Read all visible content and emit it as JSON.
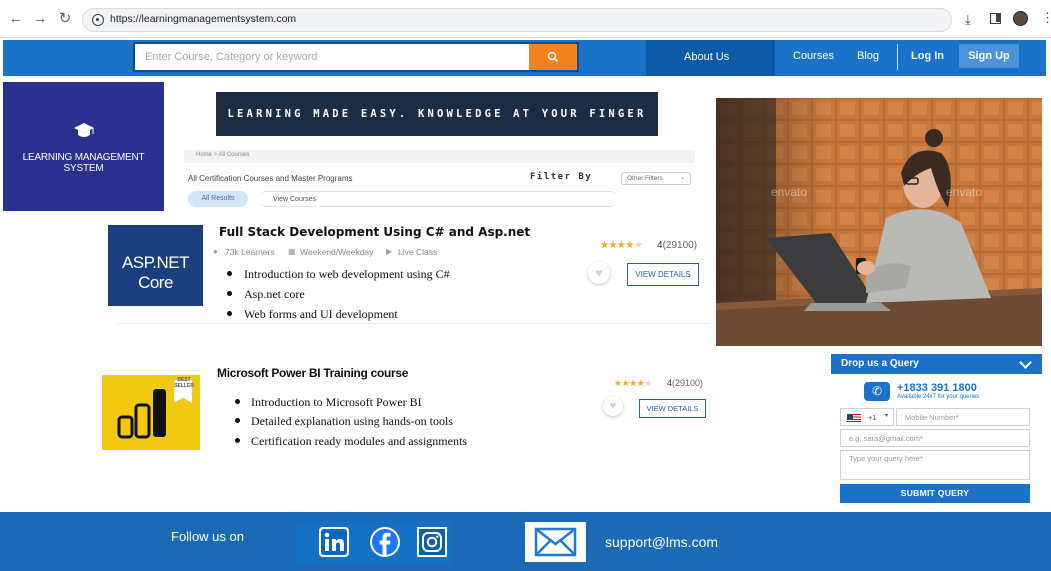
{
  "browser": {
    "url": "https://learningmanagementsystem.com",
    "icons": [
      "back-arrow-icon",
      "forward-arrow-icon",
      "reload-icon",
      "site-info-icon",
      "download-icon",
      "sidepanel-icon",
      "profile-icon",
      "more-icon"
    ]
  },
  "header": {
    "search_placeholder": "Enter Course, Category or keyword",
    "search_icon": "search-icon",
    "nav": {
      "about": "About Us",
      "courses": "Courses",
      "blog": "Blog",
      "login": "Log In",
      "signup": "Sign Up"
    }
  },
  "logo": {
    "title": "LEARNING MANAGEMENT SYSTEM",
    "icon": "graduation-cap-icon"
  },
  "banner": {
    "text": "LEARNING MADE EASY. KNOWLEDGE AT YOUR FINGER TIPS"
  },
  "listing": {
    "breadcrumb": "Home  >  All Courses",
    "heading": "All Certification Courses and Master Programs",
    "filter_by": "Filter By",
    "other_filters": "Other Filters",
    "all_results": "All Results",
    "view_courses": "View Courses"
  },
  "courses": [
    {
      "logo_text": "ASP.NET Core",
      "title": "Full Stack Development Using C# and Asp.net",
      "learners": "73k Learners",
      "schedule": "Weekend/Weekday",
      "mode": "Live Class",
      "stars": 4,
      "rating": "4",
      "reviews": "(29100)",
      "bullets": [
        "Introduction to web development using C#",
        "Asp.net core",
        "Web forms and UI development"
      ],
      "cta": "VIEW DETAILS"
    },
    {
      "logo_badge": "BEST SELLER",
      "title": "Microsoft Power BI Training course",
      "stars": 4,
      "rating": "4",
      "reviews": "(29100)",
      "bullets": [
        "Introduction to Microsoft Power BI",
        "Detailed explanation using hands-on tools",
        "Certification ready modules and assignments"
      ],
      "cta": "VIEW DETAILS"
    }
  ],
  "photo": {
    "watermark": "envato"
  },
  "query": {
    "title": "Drop us a Query",
    "phone": "+1833 391 1800",
    "availability": "Available 24x7 for your queries",
    "country_code": "+1",
    "mobile_placeholder": "Mobile Number*",
    "email_placeholder": "e.g. sara@gmail.com*",
    "query_placeholder": "Type your query here*",
    "submit": "SUBMIT QUERY"
  },
  "footer": {
    "follow": "Follow us on",
    "social": [
      "linkedin-icon",
      "facebook-icon",
      "instagram-icon"
    ],
    "email": "support@lms.com"
  },
  "colors": {
    "brand_blue": "#1a73c9",
    "accent_orange": "#f5821f",
    "logo_purple": "#2b2f8f",
    "powerbi_yellow": "#f2c811",
    "star": "#f5a623"
  }
}
